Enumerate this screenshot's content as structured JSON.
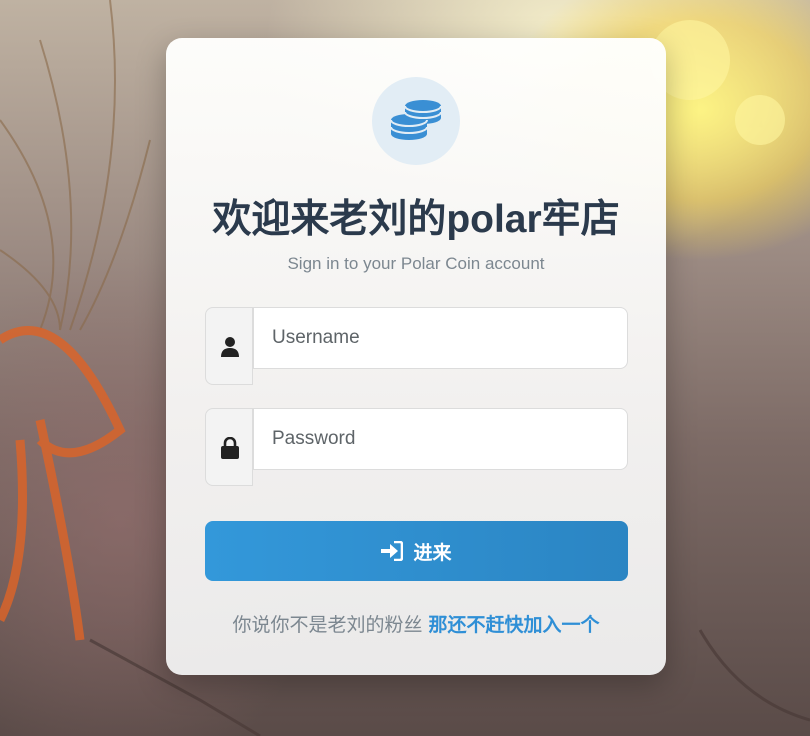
{
  "colors": {
    "title": "#2b3a4c",
    "subtitle": "#7c8790",
    "accent": "#3398da",
    "link": "#2f8fd6",
    "logo_circle": "#e2edf5"
  },
  "logo": {
    "icon": "coins-icon"
  },
  "title": "欢迎来老刘的polar牢店",
  "subtitle": "Sign in to your Polar Coin account",
  "username": {
    "icon": "user-icon",
    "placeholder": "Username",
    "value": ""
  },
  "password": {
    "icon": "lock-icon",
    "placeholder": "Password",
    "value": ""
  },
  "login_button": {
    "icon": "sign-in-icon",
    "label": "进来"
  },
  "footer": {
    "text": "你说你不是老刘的粉丝",
    "link_label": "那还不赶快加入一个"
  }
}
